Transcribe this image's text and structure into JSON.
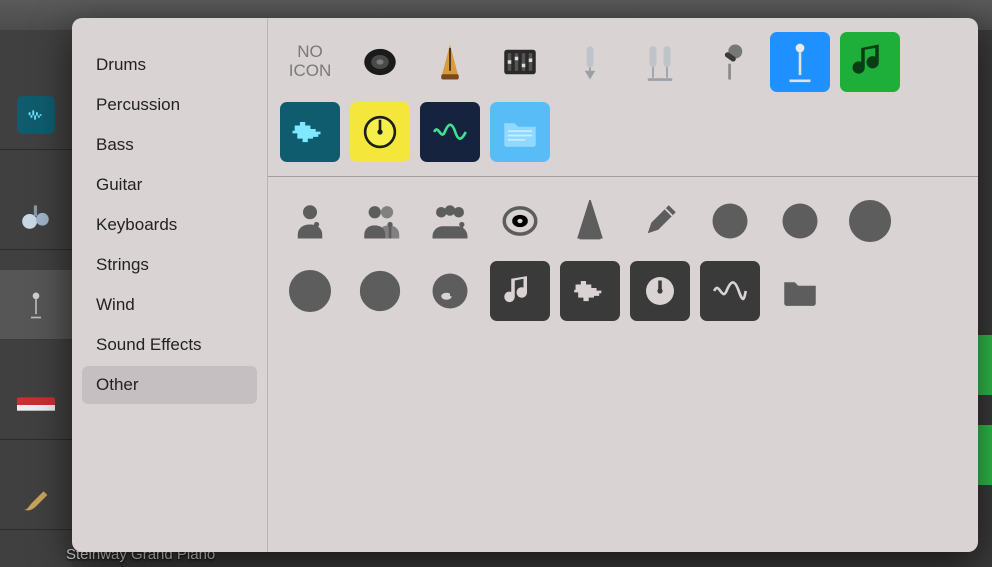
{
  "sidebar": {
    "categories": [
      {
        "label": "Drums",
        "selected": false
      },
      {
        "label": "Percussion",
        "selected": false
      },
      {
        "label": "Bass",
        "selected": false
      },
      {
        "label": "Guitar",
        "selected": false
      },
      {
        "label": "Keyboards",
        "selected": false
      },
      {
        "label": "Strings",
        "selected": false
      },
      {
        "label": "Wind",
        "selected": false
      },
      {
        "label": "Sound Effects",
        "selected": false
      },
      {
        "label": "Other",
        "selected": true
      }
    ]
  },
  "icon_picker": {
    "no_icon_label": "NO ICON",
    "row1": [
      {
        "name": "no-icon",
        "variant": "text"
      },
      {
        "name": "speaker-icon",
        "variant": "plain"
      },
      {
        "name": "metronome-icon",
        "variant": "plain"
      },
      {
        "name": "mixer-icon",
        "variant": "plain"
      },
      {
        "name": "mic-single-icon",
        "variant": "plain"
      },
      {
        "name": "mic-pair-icon",
        "variant": "plain"
      },
      {
        "name": "mic-dynamic-icon",
        "variant": "plain"
      },
      {
        "name": "mic-stand-icon",
        "variant": "selected"
      },
      {
        "name": "music-note-icon",
        "variant": "green"
      },
      {
        "name": "waveform-icon",
        "variant": "teal"
      }
    ],
    "row2": [
      {
        "name": "clock-yellow-icon",
        "variant": "yellow"
      },
      {
        "name": "waveform-small-icon",
        "variant": "darkblue"
      },
      {
        "name": "folder-icon",
        "variant": "lightblue"
      }
    ],
    "grid": [
      {
        "name": "person-mic-icon"
      },
      {
        "name": "person-pair-mic-icon"
      },
      {
        "name": "group-mic-icon"
      },
      {
        "name": "speaker-outline-icon"
      },
      {
        "name": "metronome-outline-icon"
      },
      {
        "name": "pen-icon"
      },
      {
        "name": "music-circle-icon"
      },
      {
        "name": "fader-circle-icon"
      },
      {
        "name": "dial-icon"
      },
      {
        "name": "clock-circle-icon"
      },
      {
        "name": "compass-icon"
      },
      {
        "name": "note-circle-icon"
      },
      {
        "name": "music-tile-icon"
      },
      {
        "name": "waveform-tile-icon"
      },
      {
        "name": "clock-tile-icon"
      },
      {
        "name": "wave-tile-icon"
      },
      {
        "name": "folder-outline-icon"
      }
    ]
  },
  "background": {
    "bottom_track_label": "Steinway Grand Piano"
  }
}
